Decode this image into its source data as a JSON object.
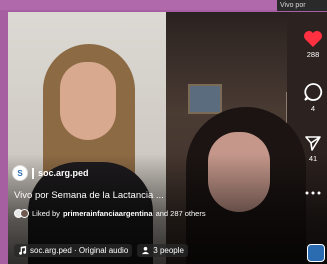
{
  "corner_label": "Vivo por",
  "account": {
    "username": "soc.arg.ped",
    "avatar_text": "S"
  },
  "caption": "Vivo por Semana de la Lactancia ...",
  "likes": {
    "prefix": "Liked by ",
    "by": "primerainfanciaargentina",
    "suffix": " and 287 others"
  },
  "audio": {
    "label": "soc.arg.ped · Original audio"
  },
  "participants": {
    "label": "3 people"
  },
  "rail": {
    "likes_count": "288",
    "comments_count": "4",
    "shares_count": "41"
  },
  "colors": {
    "heart": "#ff3040",
    "background": "#a65fa0"
  }
}
